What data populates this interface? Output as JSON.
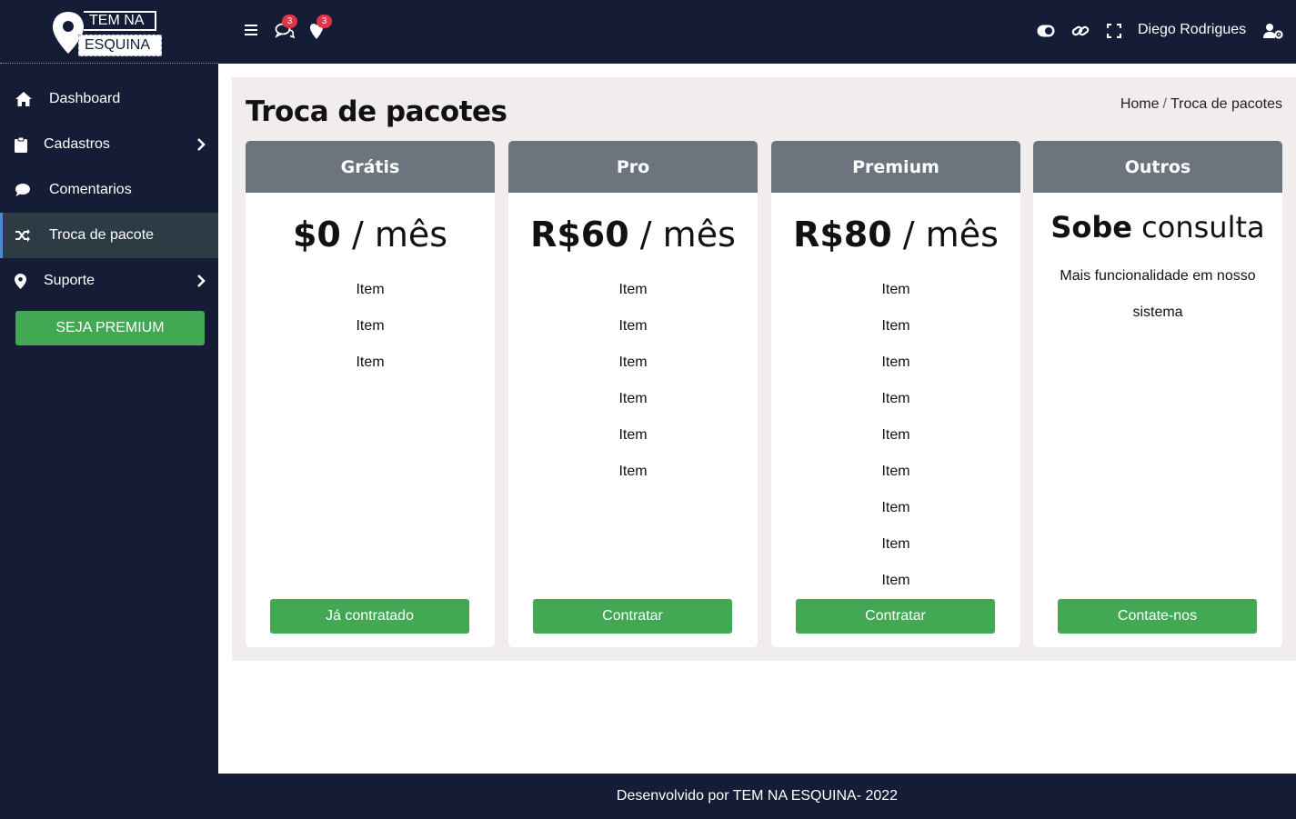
{
  "brand": {
    "line1": "TEM NA",
    "line2": "ESQUINA"
  },
  "sidebar": {
    "items": [
      {
        "label": "Dashboard",
        "icon": "home-icon"
      },
      {
        "label": "Cadastros",
        "icon": "clipboard-icon",
        "has_submenu": true
      },
      {
        "label": "Comentarios",
        "icon": "comment-icon"
      },
      {
        "label": "Troca de pacote",
        "icon": "shuffle-icon",
        "active": true
      },
      {
        "label": "Suporte",
        "icon": "map-marker-icon",
        "has_submenu": true
      }
    ],
    "premium_button": "SEJA PREMIUM"
  },
  "topbar": {
    "comments_badge": "3",
    "locations_badge": "3",
    "user_name": "Diego Rodrigues"
  },
  "page": {
    "title": "Troca de pacotes",
    "breadcrumb": {
      "home": "Home",
      "separator": "/",
      "current": "Troca de pacotes"
    }
  },
  "plans": [
    {
      "name": "Grátis",
      "price": "$0",
      "period": "/ mês",
      "items": [
        "Item",
        "Item",
        "Item"
      ],
      "button": "Já contratado"
    },
    {
      "name": "Pro",
      "price": "R$60",
      "period": "/ mês",
      "items": [
        "Item",
        "Item",
        "Item",
        "Item",
        "Item",
        "Item"
      ],
      "button": "Contratar"
    },
    {
      "name": "Premium",
      "price": "R$80",
      "period": "/ mês",
      "items": [
        "Item",
        "Item",
        "Item",
        "Item",
        "Item",
        "Item",
        "Item",
        "Item",
        "Item"
      ],
      "button": "Contratar"
    },
    {
      "name": "Outros",
      "price_bold": "Sobe",
      "price_rest": "consulta",
      "description": "Mais funcionalidade em nosso sistema",
      "button": "Contate-nos"
    }
  ],
  "footer": {
    "text": "Desenvolvido por TEM NA ESQUINA- 2022"
  },
  "colors": {
    "sidebar_bg": "#141c36",
    "accent_green": "#43a853",
    "card_header": "#6c757d",
    "content_bg": "#f0edec",
    "badge_red": "#dc3545"
  }
}
